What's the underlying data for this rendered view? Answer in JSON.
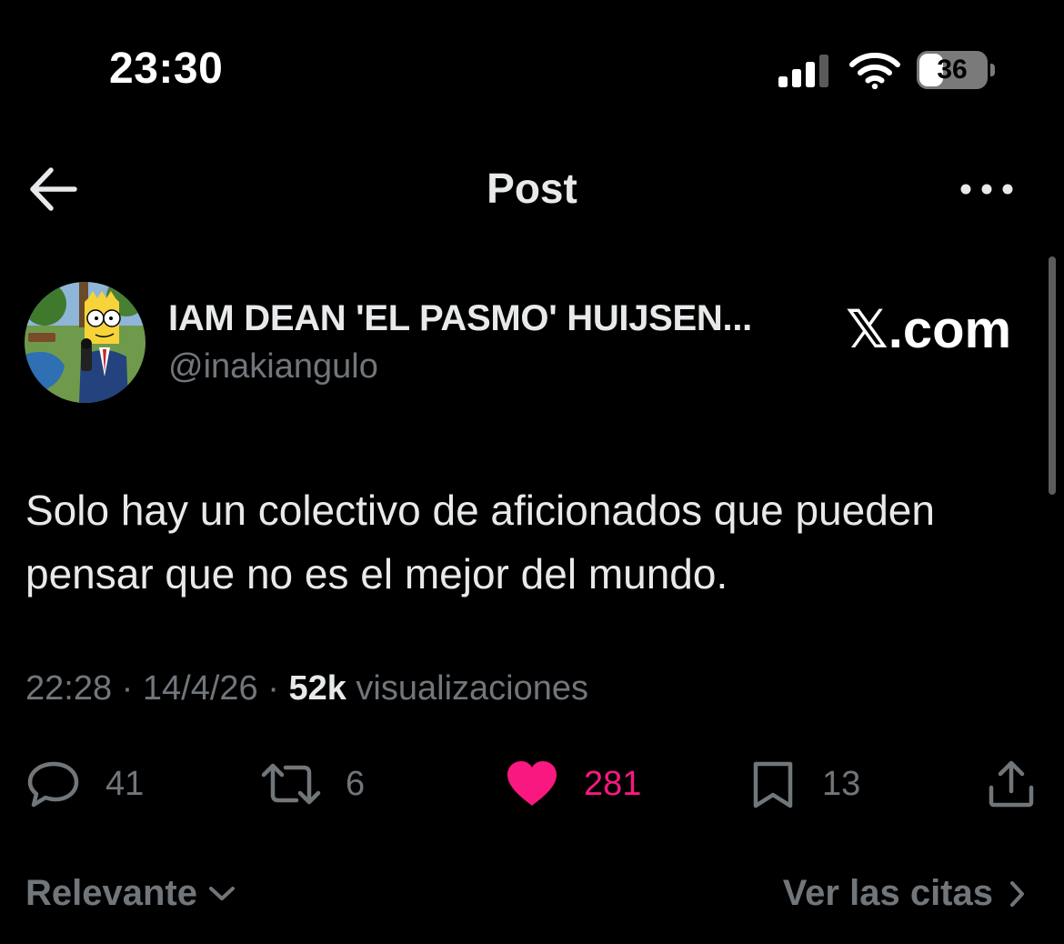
{
  "status_bar": {
    "time": "23:30",
    "battery_level": "36",
    "battery_fraction": 0.36
  },
  "header": {
    "title": "Post",
    "back_icon": "arrow-left-icon",
    "more_icon": "more-horizontal-icon"
  },
  "post": {
    "author_name": "IAM DEAN 'EL PASMO' HUIJSEN...",
    "author_handle": "@inakiangulo",
    "watermark": "𝕏.com",
    "text": "Solo hay un colectivo de aficionados que pueden pensar que no es el mejor del mundo.",
    "time": "22:28",
    "separator": " · ",
    "date": "14/4/26",
    "views_count": "52k",
    "views_label": " visualizaciones"
  },
  "actions": {
    "replies": "41",
    "reposts": "6",
    "likes": "281",
    "bookmarks": "13",
    "liked": true
  },
  "replies_bar": {
    "sort_label": "Relevante",
    "quotes_label": "Ver las citas"
  },
  "colors": {
    "background": "#000000",
    "text_primary": "#e7e9ea",
    "text_secondary": "#71767b",
    "like_accent": "#f91880"
  }
}
